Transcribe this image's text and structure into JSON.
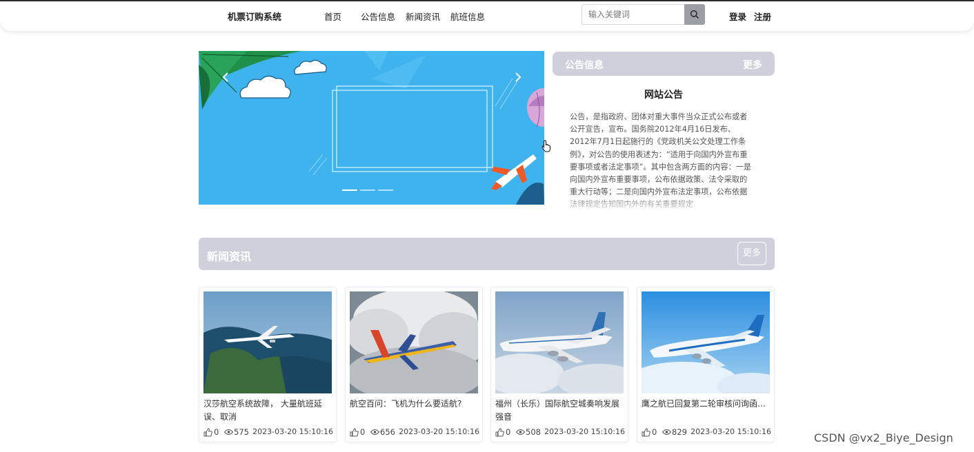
{
  "navbar": {
    "brand": "机票订购系统",
    "items": [
      {
        "label": "首页"
      },
      {
        "label": "公告信息"
      },
      {
        "label": "新闻资讯"
      },
      {
        "label": "航班信息"
      }
    ],
    "search": {
      "placeholder": "输入关键词",
      "value": ""
    },
    "login": "登录",
    "register": "注册"
  },
  "carousel": {
    "prev_icon": "chevron-left-icon",
    "next_icon": "chevron-right-icon",
    "slide_count": 3,
    "active_slide": 1
  },
  "notice": {
    "header_title": "公告信息",
    "header_more": "更多",
    "title": "网站公告",
    "body": "公告，是指政府、团体对重大事件当众正式公布或者公开宣告，宣布。国务院2012年4月16日发布、2012年7月1日起施行的《党政机关公文处理工作条例》，对公告的使用表述为：“适用于向国内外宣布重要事项或者法定事项”。其中包含两方面的内容：一是向国内外宣布重要事项，公布依据政策、法令采取的重大行动等；二是向国内外宣布法定事项，公布依据法律规定告知国内外的有关重要规定"
  },
  "news": {
    "header_title": "新闻资讯",
    "header_more": "更多",
    "cards": [
      {
        "title": "汉莎航空系统故障， 大量航班延误、取消",
        "likes": "0",
        "views": "575",
        "date": "2023-03-20 15:10:16"
      },
      {
        "title": "航空百问：飞机为什么要适航?",
        "likes": "0",
        "views": "656",
        "date": "2023-03-20 15:10:16"
      },
      {
        "title": "福州（长乐）国际航空城奏响发展强音",
        "likes": "0",
        "views": "508",
        "date": "2023-03-20 15:10:16"
      },
      {
        "title": "鹰之航已回复第二轮审核问询函：国家高新技术企业，助力提高国产民用航空维修水平",
        "likes": "0",
        "views": "829",
        "date": "2023-03-20 15:10:16"
      }
    ]
  },
  "watermark": "CSDN @vx2_Biye_Design",
  "colors": {
    "panel_header": "#cfd0db",
    "carousel_bg": "#3fb3ee",
    "search_button": "#9b9ea4"
  }
}
